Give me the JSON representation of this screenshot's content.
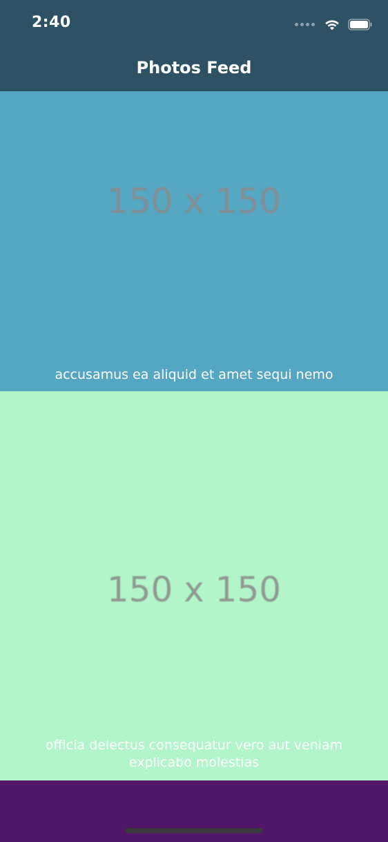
{
  "status_bar": {
    "time": "2:40",
    "icons": [
      "signal-dots-icon",
      "wifi-icon",
      "battery-icon"
    ]
  },
  "nav": {
    "title": "Photos Feed",
    "background": "#2e5263"
  },
  "feed": {
    "items": [
      {
        "placeholder": "150 x 150",
        "caption": "accusamus ea aliquid et amet sequi nemo",
        "color": "#54a6c3"
      },
      {
        "placeholder": "150 x 150",
        "caption": "officia delectus consequatur vero aut veniam explicabo molestias",
        "color": "#b2f5ca"
      }
    ],
    "next_item_color": "#511869"
  }
}
